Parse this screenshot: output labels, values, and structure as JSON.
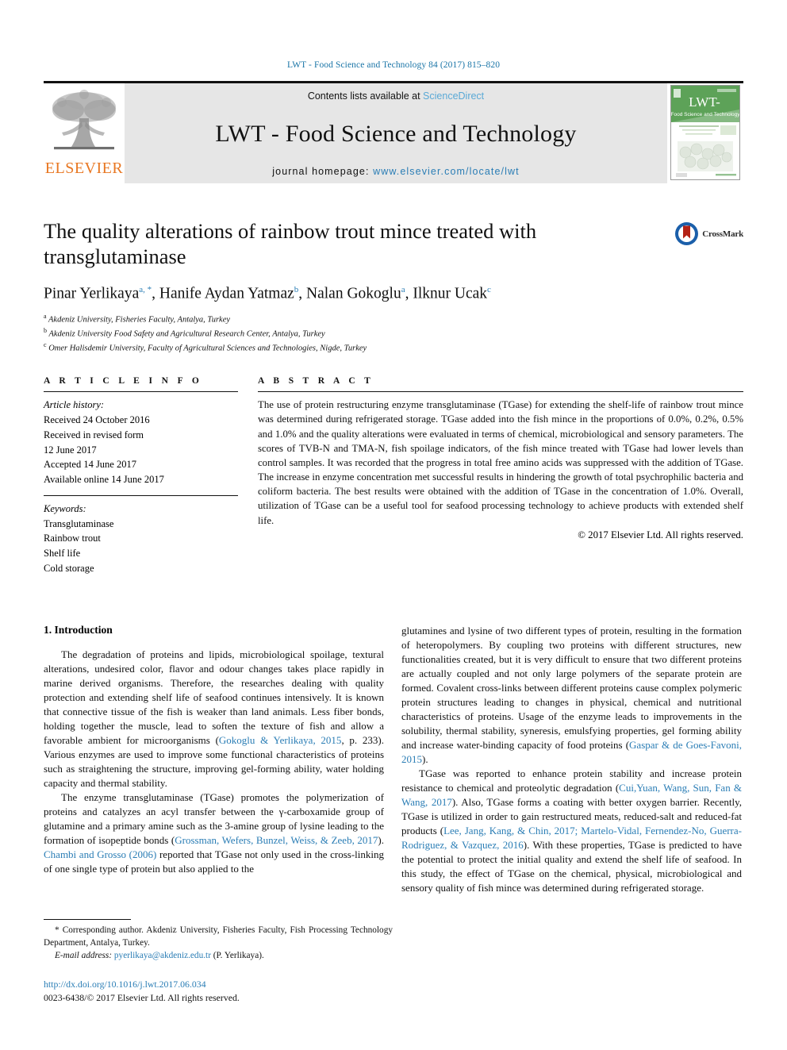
{
  "running_head": "LWT - Food Science and Technology 84 (2017) 815–820",
  "banner": {
    "publisher_name": "ELSEVIER",
    "contents_prefix": "Contents lists available at ",
    "contents_link": "ScienceDirect",
    "journal_title": "LWT - Food Science and Technology",
    "homepage_prefix": "journal homepage: ",
    "homepage_url": "www.elsevier.com/locate/lwt",
    "cover_title": "LWT-",
    "cover_subtitle": "Food Science and Technology",
    "link_color": "#5aa9d6",
    "url_color": "#2a7db5",
    "elsevier_orange": "#e87722"
  },
  "crossmark": {
    "label": "CrossMark",
    "ring_color": "#1b5faa",
    "bookmark_color": "#b42216"
  },
  "article": {
    "title": "The quality alterations of rainbow trout mince treated with transglutaminase",
    "authors_html": "Pinar Yerlikaya a,*, Hanife Aydan Yatmaz b, Nalan Gokoglu a, Ilknur Ucak c",
    "authors": [
      {
        "name": "Pinar Yerlikaya",
        "marks": "a, *"
      },
      {
        "name": "Hanife Aydan Yatmaz",
        "marks": "b"
      },
      {
        "name": "Nalan Gokoglu",
        "marks": "a"
      },
      {
        "name": "Ilknur Ucak",
        "marks": "c"
      }
    ],
    "affiliations": [
      {
        "mark": "a",
        "text": "Akdeniz University, Fisheries Faculty, Antalya, Turkey"
      },
      {
        "mark": "b",
        "text": "Akdeniz University Food Safety and Agricultural Research Center, Antalya, Turkey"
      },
      {
        "mark": "c",
        "text": "Omer Halisdemir University, Faculty of Agricultural Sciences and Technologies, Nigde, Turkey"
      }
    ]
  },
  "article_info": {
    "heading": "A R T I C L E   I N F O",
    "history_label": "Article history:",
    "history_lines": [
      "Received 24 October 2016",
      "Received in revised form",
      "12 June 2017",
      "Accepted 14 June 2017",
      "Available online 14 June 2017"
    ],
    "keywords_label": "Keywords:",
    "keywords": [
      "Transglutaminase",
      "Rainbow trout",
      "Shelf life",
      "Cold storage"
    ]
  },
  "abstract": {
    "heading": "A B S T R A C T",
    "text": "The use of protein restructuring enzyme transglutaminase (TGase) for extending the shelf-life of rainbow trout mince was determined during refrigerated storage. TGase added into the fish mince in the proportions of 0.0%, 0.2%, 0.5% and 1.0% and the quality alterations were evaluated in terms of chemical, microbiological and sensory parameters. The scores of TVB-N and TMA-N, fish spoilage indicators, of the fish mince treated with TGase had lower levels than control samples. It was recorded that the progress in total free amino acids was suppressed with the addition of TGase. The increase in enzyme concentration met successful results in hindering the growth of total psychrophilic bacteria and coliform bacteria. The best results were obtained with the addition of TGase in the concentration of 1.0%. Overall, utilization of TGase can be a useful tool for seafood processing technology to achieve products with extended shelf life.",
    "copyright": "© 2017 Elsevier Ltd. All rights reserved."
  },
  "introduction": {
    "heading": "1. Introduction",
    "left_para_1_a": "The degradation of proteins and lipids, microbiological spoilage, textural alterations, undesired color, flavor and odour changes takes place rapidly in marine derived organisms. Therefore, the researches dealing with quality protection and extending shelf life of seafood continues intensively. It is known that connective tissue of the fish is weaker than land animals. Less fiber bonds, holding together the muscle, lead to soften the texture of fish and allow a favorable ambient for microorganisms (",
    "left_para_1_ref": "Gokoglu & Yerlikaya, 2015",
    "left_para_1_b": ", p. 233). Various enzymes are used to improve some functional characteristics of proteins such as straightening the structure, improving gel-forming ability, water holding capacity and thermal stability.",
    "left_para_2_a": "The enzyme transglutaminase (TGase) promotes the polymerization of proteins and catalyzes an acyl transfer between the γ-carboxamide group of glutamine and a primary amine such as the 3-amine group of lysine leading to the formation of isopeptide bonds (",
    "left_para_2_ref1": "Grossman, Wefers, Bunzel, Weiss, & Zeeb, 2017",
    "left_para_2_mid": "). ",
    "left_para_2_ref2": "Chambi and Grosso (2006)",
    "left_para_2_b": " reported that TGase not only used in the cross-linking of one single type of protein but also applied to the",
    "right_para_1_a": "glutamines and lysine of two different types of protein, resulting in the formation of heteropolymers. By coupling two proteins with different structures, new functionalities created, but it is very difficult to ensure that two different proteins are actually coupled and not only large polymers of the separate protein are formed. Covalent cross-links between different proteins cause complex polymeric protein structures leading to changes in physical, chemical and nutritional characteristics of proteins. Usage of the enzyme leads to improvements in the solubility, thermal stability, syneresis, emulsfying properties, gel forming ability and increase water-binding capacity of food proteins (",
    "right_para_1_ref": "Gaspar & de Goes-Favoni, 2015",
    "right_para_1_b": ").",
    "right_para_2_a": "TGase was reported to enhance protein stability and increase protein resistance to chemical and proteolytic degradation (",
    "right_para_2_ref1": "Cui,Yuan, Wang, Sun, Fan & Wang, 2017",
    "right_para_2_mid": "). Also, TGase forms a coating with better oxygen barrier. Recently, TGase is utilized in order to gain restructured meats, reduced-salt and reduced-fat products (",
    "right_para_2_ref2": "Lee, Jang, Kang, & Chin, 2017; Martelo-Vidal, Fernendez-No, Guerra-Rodriguez, & Vazquez, 2016",
    "right_para_2_b": "). With these properties, TGase is predicted to have the potential to protect the initial quality and extend the shelf life of seafood. In this study, the effect of TGase on the chemical, physical, microbiological and sensory quality of fish mince was determined during refrigerated storage."
  },
  "footnotes": {
    "corresponding": "* Corresponding author. Akdeniz University, Fisheries Faculty, Fish Processing Technology Department, Antalya, Turkey.",
    "email_label": "E-mail address:",
    "email": "pyerlikaya@akdeniz.edu.tr",
    "email_suffix": " (P. Yerlikaya).",
    "doi": "http://dx.doi.org/10.1016/j.lwt.2017.06.034",
    "issn": "0023-6438/© 2017 Elsevier Ltd. All rights reserved."
  }
}
